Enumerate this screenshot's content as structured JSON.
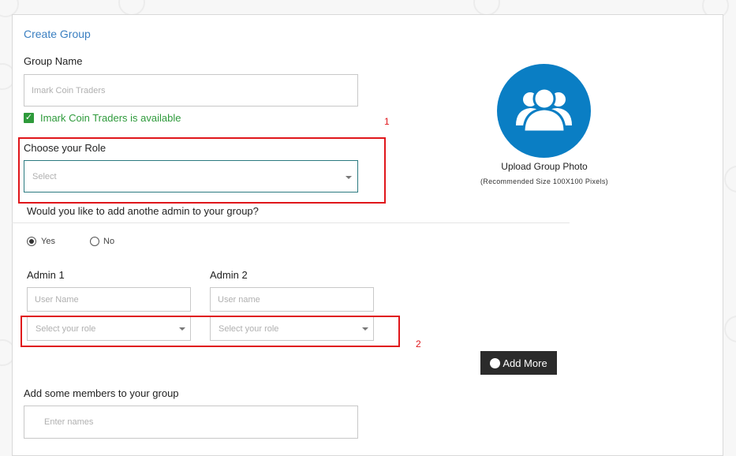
{
  "form": {
    "title": "Create Group",
    "group_name_label": "Group Name",
    "group_name_placeholder": "Imark Coin Traders",
    "availability_text": "Imark Coin Traders is available",
    "role_label": "Choose your Role",
    "role_select_value": "Select",
    "admin_question": "Would you like to add anothe admin to your group?",
    "radio_yes": "Yes",
    "radio_no": "No",
    "radio_selected": "Yes",
    "admin1_label": "Admin 1",
    "admin1_username_placeholder": "User Name",
    "admin1_role_value": "Select your role",
    "admin2_label": "Admin 2",
    "admin2_username_placeholder": "User name",
    "admin2_role_value": "Select your role",
    "add_more_label": "Add More",
    "members_label": "Add some members to your group",
    "members_placeholder": "Enter names"
  },
  "photo": {
    "upload_label": "Upload Group Photo",
    "recommendation": "(Recommended Size 100X100 Pixels)",
    "avatar_color": "#0a7ec4",
    "icon": "group-icon"
  },
  "annotations": {
    "box1_number": "1",
    "box2_number": "2",
    "box_color": "#e0161b"
  }
}
